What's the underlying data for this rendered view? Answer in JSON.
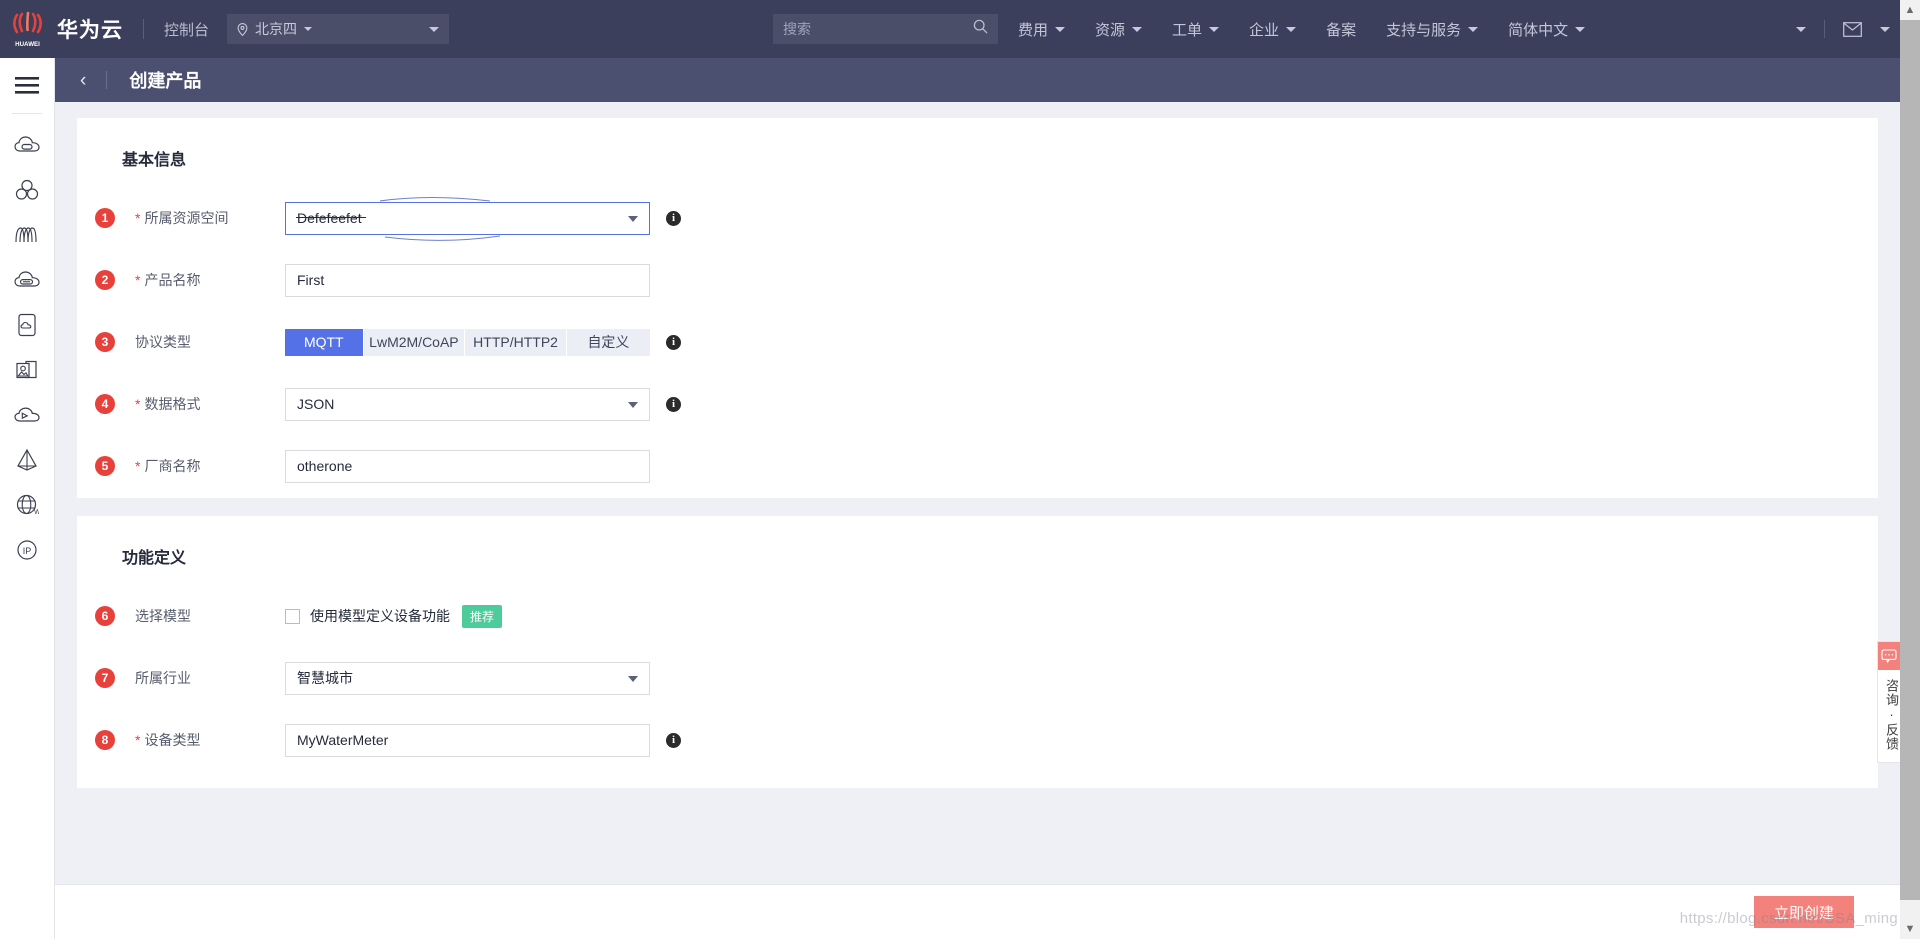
{
  "topnav": {
    "brand": "华为云",
    "console": "控制台",
    "region": "北京四",
    "search_placeholder": "搜索",
    "items": [
      {
        "label": "费用",
        "caret": true
      },
      {
        "label": "资源",
        "caret": true
      },
      {
        "label": "工单",
        "caret": true
      },
      {
        "label": "企业",
        "caret": true
      },
      {
        "label": "备案",
        "caret": false
      },
      {
        "label": "支持与服务",
        "caret": true
      },
      {
        "label": "简体中文",
        "caret": true
      }
    ]
  },
  "page": {
    "title": "创建产品",
    "back": "‹"
  },
  "basic": {
    "section_title": "基本信息",
    "fields": [
      {
        "num": "1",
        "required": true,
        "label": "所属资源空间",
        "type": "select",
        "value": "Defefeefet",
        "info": true,
        "focused": true,
        "struck": true
      },
      {
        "num": "2",
        "required": true,
        "label": "产品名称",
        "type": "input",
        "value": "First",
        "info": false
      },
      {
        "num": "3",
        "required": false,
        "label": "协议类型",
        "type": "tabs",
        "info": true
      },
      {
        "num": "4",
        "required": true,
        "label": "数据格式",
        "type": "select",
        "value": "JSON",
        "info": true
      },
      {
        "num": "5",
        "required": true,
        "label": "厂商名称",
        "type": "input",
        "value": "otherone",
        "info": false
      }
    ],
    "protocol_tabs": [
      {
        "label": "MQTT",
        "active": true
      },
      {
        "label": "LwM2M/CoAP",
        "active": false
      },
      {
        "label": "HTTP/HTTP2",
        "active": false
      },
      {
        "label": "自定义",
        "active": false
      }
    ]
  },
  "func": {
    "section_title": "功能定义",
    "model": {
      "num": "6",
      "label": "选择模型",
      "checkbox_label": "使用模型定义设备功能",
      "checked": false,
      "pill": "推荐"
    },
    "industry": {
      "num": "7",
      "label": "所属行业",
      "value": "智慧城市"
    },
    "device_type": {
      "num": "8",
      "required": true,
      "label": "设备类型",
      "value": "MyWaterMeter",
      "info": true
    }
  },
  "footer": {
    "create_label": "立即创建"
  },
  "feedback": {
    "text": "咨询·反馈"
  },
  "watermark": {
    "text": "https://blog.csdn.net/SSA_ming"
  },
  "colors": {
    "nav_bg": "#3b3f5c",
    "pageheader_bg": "#4c5070",
    "accent_blue": "#5471e8",
    "badge_red": "#e8413c",
    "create_btn": "#f4827c",
    "pill_green": "#4ecb9a",
    "page_bg": "#eef0f5"
  },
  "icons": {
    "rail": [
      "menu-icon",
      "cloud-server-icon",
      "cluster-icon",
      "network-icon",
      "cloud-storage-icon",
      "mobile-cloud-icon",
      "image-stack-icon",
      "cloud-play-icon",
      "pyramid-icon",
      "globe-w-icon",
      "ip-icon"
    ]
  }
}
